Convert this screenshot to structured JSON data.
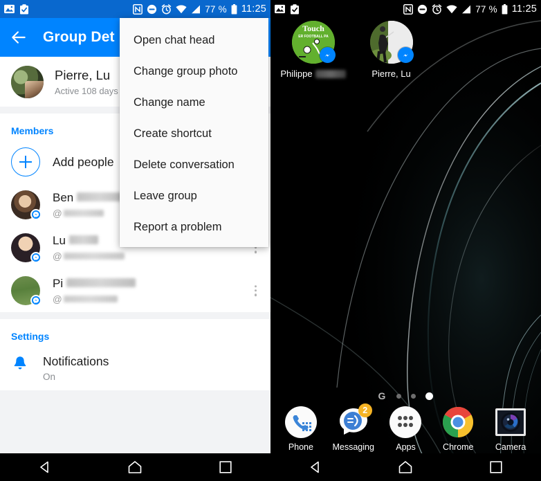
{
  "statusbar": {
    "icons_left": [
      "image-icon",
      "clipboard-check-icon"
    ],
    "icons_right": [
      "nfc-icon",
      "do-not-disturb-icon",
      "alarm-icon",
      "wifi-icon",
      "signal-icon"
    ],
    "battery_percent": "77 %",
    "time": "11:25"
  },
  "left_screen": {
    "appbar": {
      "back_label": "Back",
      "title": "Group Det"
    },
    "thread": {
      "name": "Pierre, Lu",
      "subtitle": "Active 108 days"
    },
    "members_section": {
      "title": "Members",
      "add_people_label": "Add people"
    },
    "members": [
      {
        "name": "Ben",
        "handle": "@",
        "name_redact_width": 66,
        "handle_redact_width": 58
      },
      {
        "name": "Lu",
        "handle": "@",
        "name_redact_width": 42,
        "handle_redact_width": 88
      },
      {
        "name": "Pi",
        "handle": "@",
        "name_redact_width": 100,
        "handle_redact_width": 78
      }
    ],
    "settings_section": {
      "title": "Settings"
    },
    "settings": {
      "notifications_title": "Notifications",
      "notifications_value": "On"
    },
    "popup_menu": {
      "items": [
        "Open chat head",
        "Change group photo",
        "Change name",
        "Create shortcut",
        "Delete conversation",
        "Leave group",
        "Report a problem"
      ]
    },
    "colors": {
      "appbar": "#0084ff",
      "statusbar": "#0968ce",
      "accent": "#0084ff",
      "background": "#f2f3f5"
    }
  },
  "right_screen": {
    "shortcuts": [
      {
        "label": "Philippe",
        "redacted": true,
        "badge": "messenger-icon"
      },
      {
        "label": "Pierre, Lu",
        "redacted": false,
        "badge": "messenger-icon"
      }
    ],
    "page_indicator": {
      "google_glyph": "G",
      "pages": 3,
      "active_page": 3
    },
    "dock": [
      {
        "label": "Phone",
        "icon": "phone-icon",
        "badge": null
      },
      {
        "label": "Messaging",
        "icon": "messaging-icon",
        "badge": "2"
      },
      {
        "label": "Apps",
        "icon": "app-drawer-icon",
        "badge": null
      },
      {
        "label": "Chrome",
        "icon": "chrome-icon",
        "badge": null
      },
      {
        "label": "Camera",
        "icon": "camera-icon",
        "badge": null
      }
    ]
  },
  "navbar": {
    "back": "back-nav",
    "home": "home-nav",
    "recents": "recents-nav"
  }
}
